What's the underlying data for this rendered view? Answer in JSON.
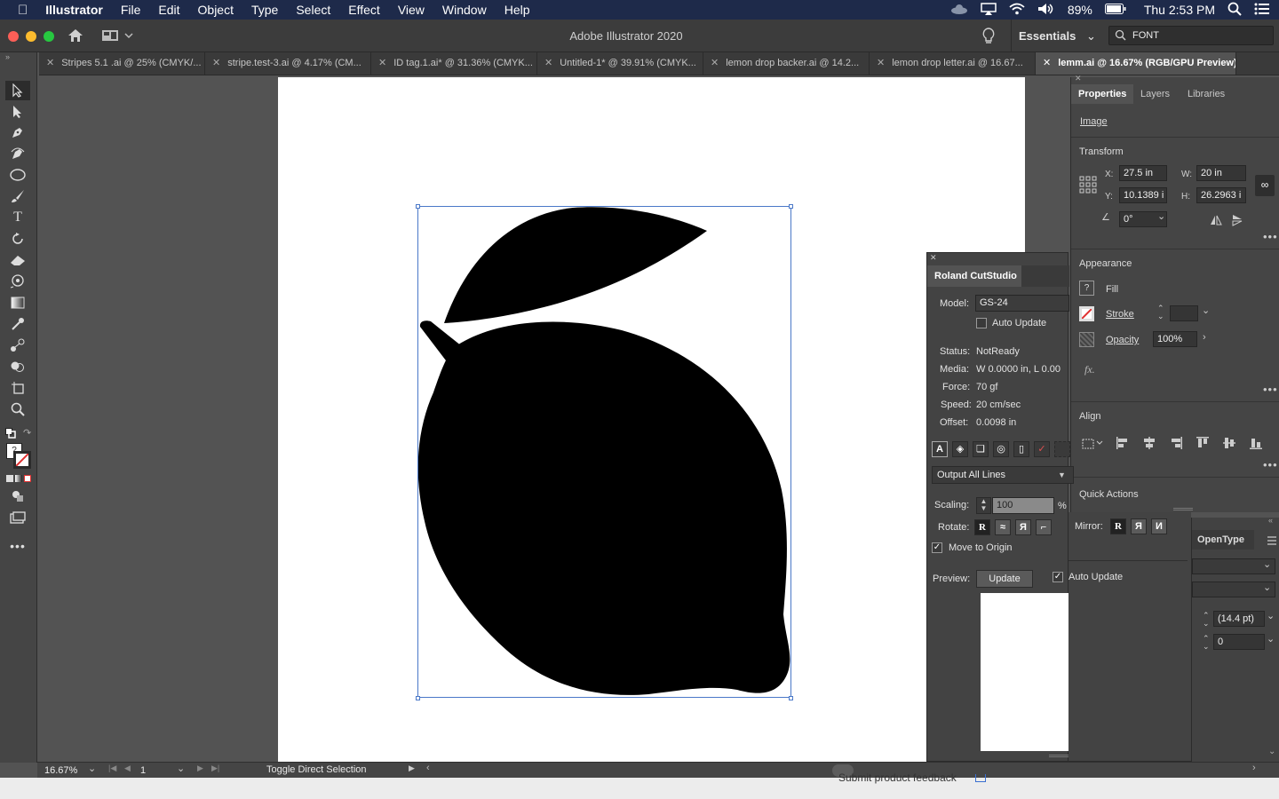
{
  "menubar": {
    "app_name": "Illustrator",
    "items": [
      "File",
      "Edit",
      "Object",
      "Type",
      "Select",
      "Effect",
      "View",
      "Window",
      "Help"
    ],
    "battery": "89%",
    "clock": "Thu 2:53 PM"
  },
  "titlebar": {
    "title": "Adobe Illustrator 2020",
    "workspace": "Essentials",
    "search_value": "FONT"
  },
  "tabs": [
    {
      "label": "Stripes 5.1 .ai @ 25% (CMYK/..."
    },
    {
      "label": "stripe.test-3.ai @ 4.17% (CM..."
    },
    {
      "label": "ID tag.1.ai* @ 31.36% (CMYK..."
    },
    {
      "label": "Untitled-1* @ 39.91% (CMYK..."
    },
    {
      "label": "lemon drop backer.ai @ 14.2..."
    },
    {
      "label": "lemon drop letter.ai @ 16.67..."
    },
    {
      "label": "lemm.ai @ 16.67% (RGB/GPU Preview)"
    }
  ],
  "statusbar": {
    "zoom": "16.67%",
    "artboard": "1",
    "status": "Toggle Direct Selection",
    "feedback": "Submit product feedback"
  },
  "properties": {
    "tabs": [
      "Properties",
      "Layers",
      "Libraries"
    ],
    "selection_type": "Image",
    "transform": {
      "title": "Transform",
      "x_label": "X:",
      "x": "27.5 in",
      "y_label": "Y:",
      "y": "10.1389 i",
      "w_label": "W:",
      "w": "20 in",
      "h_label": "H:",
      "h": "26.2963 i",
      "angle": "0°"
    },
    "appearance": {
      "title": "Appearance",
      "fill": "Fill",
      "fill_swatch": "?",
      "stroke": "Stroke",
      "opacity": "Opacity",
      "opacity_value": "100%",
      "fx": "fx."
    },
    "align": {
      "title": "Align"
    },
    "quick_actions": {
      "title": "Quick Actions"
    }
  },
  "roland": {
    "title": "Roland CutStudio",
    "model_label": "Model:",
    "model": "GS-24",
    "auto_update_label": "Auto Update",
    "status_label": "Status:",
    "status": "NotReady",
    "media_label": "Media:",
    "media": "W 0.0000 in, L 0.00",
    "force_label": "Force:",
    "force": "70 gf",
    "speed_label": "Speed:",
    "speed": "20 cm/sec",
    "offset_label": "Offset:",
    "offset": "0.0098 in",
    "output": "Output All Lines",
    "scaling_label": "Scaling:",
    "scaling": "100",
    "scaling_unit": "%",
    "rotate_label": "Rotate:",
    "mirror_label": "Mirror:",
    "rotate_glyphs": [
      "R",
      "≈",
      "Я",
      "⌐"
    ],
    "mirror_glyphs": [
      "R",
      "Я",
      "И"
    ],
    "move_origin_label": "Move to Origin",
    "preview_label": "Preview:",
    "update_button": "Update",
    "auto_update2_label": "Auto Update"
  },
  "opentype": {
    "title": "OpenType",
    "leading": "(14.4 pt)",
    "tracking": "0"
  }
}
